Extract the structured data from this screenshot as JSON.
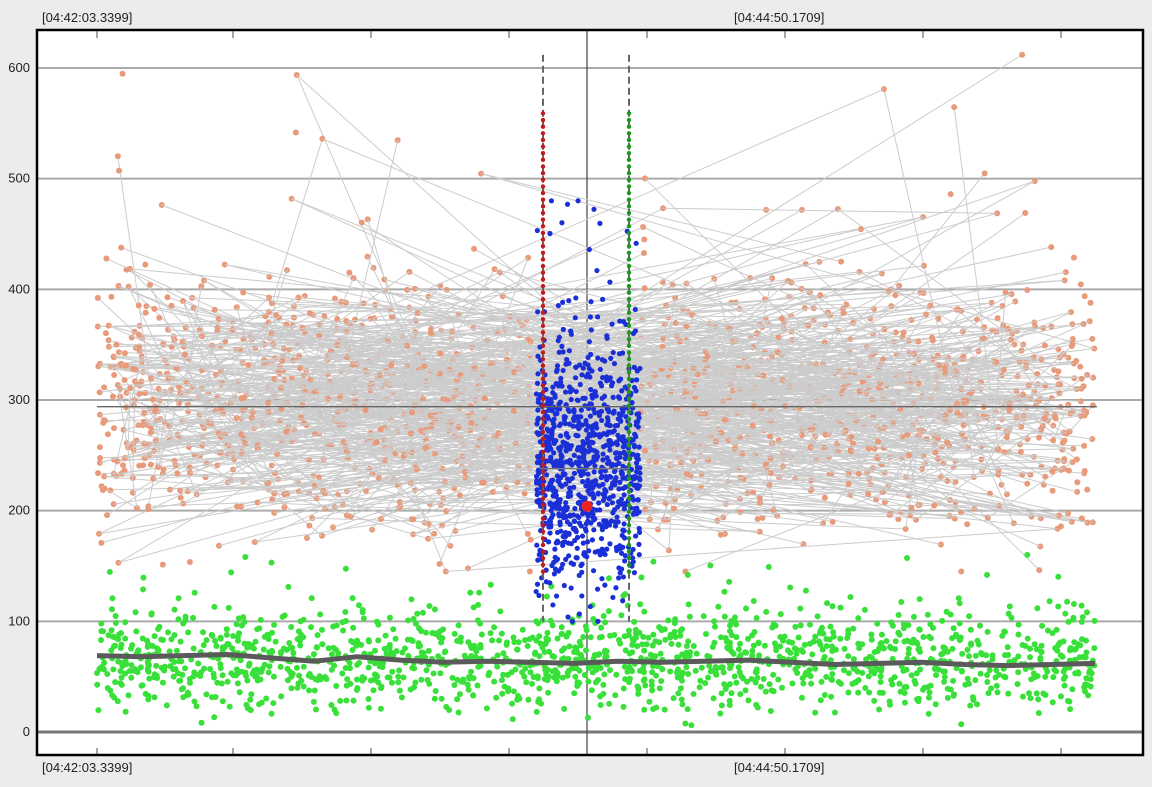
{
  "timestamps": {
    "top_left": "[04:42:03.3399]",
    "top_mid": "[04:44:50.1709]",
    "bottom_left": "[04:42:03.3399]",
    "bottom_mid": "[04:44:50.1709]"
  },
  "colors": {
    "background": "#ececec",
    "plot_bg": "#ffffff",
    "orange_series": "#e89a7a",
    "green_series": "#3ae03a",
    "blue_series": "#1a2fd6",
    "red_marker_line": "#c41a1a",
    "green_marker_line": "#1a9a1a",
    "trend_line": "#5a5a5a",
    "highlight_point": "#ee2222"
  },
  "chart_data": {
    "type": "scatter",
    "y_ticks": [
      "0",
      "100",
      "200",
      "300",
      "400",
      "500",
      "600"
    ],
    "ylim": [
      0,
      620
    ],
    "x_range_labels": [
      "[04:42:03.3399]",
      "[04:44:50.1709]"
    ],
    "grid": true,
    "series": [
      {
        "role": "upper-band",
        "color": "#e89a7a",
        "value_range": [
          145,
          612
        ],
        "typical_center": 295
      },
      {
        "role": "lower-band",
        "color": "#3ae03a",
        "value_range": [
          0,
          160
        ],
        "typical_center": 65
      },
      {
        "role": "selected-region",
        "color": "#1a2fd6",
        "value_range": [
          100,
          480
        ],
        "typical_center": 240
      },
      {
        "role": "trend",
        "color": "#5a5a5a",
        "values": [
          69,
          68,
          69,
          70,
          67,
          64,
          68,
          65,
          63,
          64,
          63,
          62,
          64,
          63,
          64,
          65,
          63,
          61,
          62,
          63,
          61,
          60,
          61,
          62
        ]
      }
    ],
    "reference_lines": {
      "upper_mean": 294,
      "selected_mean": 238
    },
    "highlight_point": {
      "y": 204
    },
    "marker_lines": [
      {
        "color": "#c41a1a",
        "range": [
          145,
          560
        ]
      },
      {
        "color": "#1a9a1a",
        "range": [
          145,
          560
        ]
      }
    ]
  }
}
